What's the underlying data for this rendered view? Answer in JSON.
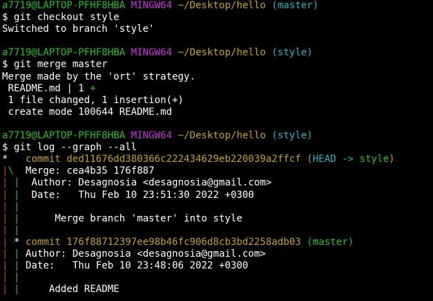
{
  "colors": {
    "background": "#000000",
    "text": "#ffffff",
    "user_host": "#23c41f",
    "mingw": "#c53bd9",
    "path": "#c8a418",
    "branch": "#19b8c5",
    "commit_yellow": "#c8a418",
    "graph_red": "#d1413b",
    "graph_green": "#23c41f",
    "head_cyan": "#19b8c5"
  },
  "prompt": {
    "user_host": "a7719@LAPTOP-PFHF8HBA",
    "system": "MINGW64",
    "path": "~/Desktop/hello"
  },
  "lines": {
    "p1_branch": "(master)",
    "cmd1": "$ git checkout style",
    "out1": "Switched to branch 'style'",
    "p2_branch": "(style)",
    "cmd2": "$ git merge master",
    "out2a": "Merge made by the 'ort' strategy.",
    "out2b_file": " README.md | 1 ",
    "out2b_plus": "+",
    "out2c": " 1 file changed, 1 insertion(+)",
    "out2d": " create mode 100644 README.md",
    "p3_branch": "(style)",
    "cmd3": "$ git log --graph --all",
    "commit1_star": "*",
    "commit1_label": "   commit ded11676dd380366c222434629eb220039a2ffcf ",
    "commit1_ref_open": "(",
    "commit1_head": "HEAD -> ",
    "commit1_branch": "style",
    "commit1_ref_close": ")",
    "graph_split_red": "|",
    "graph_split_green": "\\",
    "merge_line": "  Merge: cea4b35 176f887",
    "author1": "  Author: Desagnosia <desagnosia@gmail.com>",
    "date1": "  Date:   Thu Feb 10 23:51:30 2022 +0300",
    "msg1": "      Merge branch 'master' into style",
    "commit2_star": "*",
    "commit2_label": " commit 176f88712397ee98b46fc906d8cb3bd2258adb03 ",
    "commit2_ref": "(master)",
    "author2": " Author: Desagnosia <desagnosia@gmail.com>",
    "date2": " Date:   Thu Feb 10 23:48:06 2022 +0300",
    "msg2": "     Added README"
  }
}
